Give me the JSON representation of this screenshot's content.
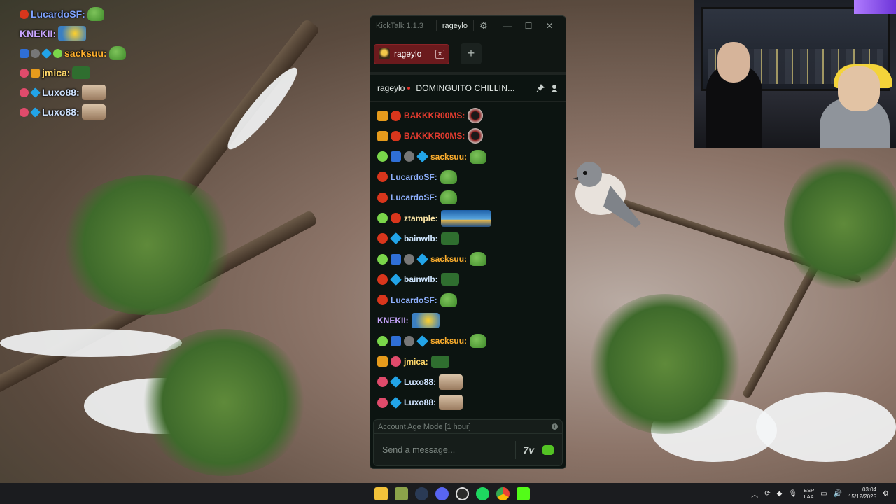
{
  "desktop": {},
  "overlay_chat": [
    {
      "user": "LucardoSF:",
      "color": "#7fa3ff",
      "badges": [
        "b-red"
      ],
      "emote": "e-pepe"
    },
    {
      "user": "KNEKII:",
      "color": "#c9a6ff",
      "badges": [],
      "emote": "e-duck"
    },
    {
      "user": "sacksuu:",
      "color": "#ffb02e",
      "badges": [
        "b-pick",
        "b-gray",
        "b-blue",
        "b-green"
      ],
      "emote": "e-pepe"
    },
    {
      "user": "jmica:",
      "color": "#ffd86a",
      "badges": [
        "b-pink",
        "b-orange"
      ],
      "emote": "e-dark"
    },
    {
      "user": "Luxo88:",
      "color": "#cfe3ff",
      "badges": [
        "b-pink",
        "b-blue"
      ],
      "emote": "e-face"
    },
    {
      "user": "Luxo88:",
      "color": "#cfe3ff",
      "badges": [
        "b-pink",
        "b-blue"
      ],
      "emote": "e-face"
    }
  ],
  "window": {
    "app_title": "KickTalk 1.1.3",
    "user_chip": "rageylo",
    "gear_icon": "⚙",
    "minimize": "—",
    "maximize": "☐",
    "close": "✕"
  },
  "tabs": [
    {
      "label": "rageylo",
      "close": "✕"
    }
  ],
  "add_tab": "+",
  "channel": {
    "name": "rageylo",
    "stream_title": "DOMINGUITO CHILLIN..."
  },
  "messages": [
    {
      "user": "BAKKKR00MS:",
      "color": "#e23b2f",
      "badges": [
        "b-orange",
        "b-red"
      ],
      "emote": "e-bakk"
    },
    {
      "user": "BAKKKR00MS:",
      "color": "#e23b2f",
      "badges": [
        "b-orange",
        "b-red"
      ],
      "emote": "e-bakk"
    },
    {
      "user": "sacksuu:",
      "color": "#ffb02e",
      "badges": [
        "b-green",
        "b-pick",
        "b-gray",
        "b-blue"
      ],
      "emote": "e-pepe"
    },
    {
      "user": "LucardoSF:",
      "color": "#8fb1ff",
      "badges": [
        "b-red"
      ],
      "emote": "e-pepe"
    },
    {
      "user": "LucardoSF:",
      "color": "#8fb1ff",
      "badges": [
        "b-red"
      ],
      "emote": "e-pepe"
    },
    {
      "user": "ztample:",
      "color": "#ffe9a8",
      "badges": [
        "b-green",
        "b-red"
      ],
      "emote": "e-boat"
    },
    {
      "user": "bainwlb:",
      "color": "#cfe6ff",
      "badges": [
        "b-red",
        "b-blue"
      ],
      "emote": "e-dark"
    },
    {
      "user": "sacksuu:",
      "color": "#ffb02e",
      "badges": [
        "b-green",
        "b-pick",
        "b-gray",
        "b-blue"
      ],
      "emote": "e-pepe"
    },
    {
      "user": "bainwlb:",
      "color": "#cfe6ff",
      "badges": [
        "b-red",
        "b-blue"
      ],
      "emote": "e-dark"
    },
    {
      "user": "LucardoSF:",
      "color": "#8fb1ff",
      "badges": [
        "b-red"
      ],
      "emote": "e-pepe"
    },
    {
      "user": "KNEKII:",
      "color": "#c9a6ff",
      "badges": [],
      "emote": "e-duck"
    },
    {
      "user": "sacksuu:",
      "color": "#ffb02e",
      "badges": [
        "b-green",
        "b-pick",
        "b-gray",
        "b-blue"
      ],
      "emote": "e-pepe"
    },
    {
      "user": "jmica:",
      "color": "#ffd86a",
      "badges": [
        "b-orange",
        "b-pink"
      ],
      "emote": "e-dark"
    },
    {
      "user": "Luxo88:",
      "color": "#cfe3ff",
      "badges": [
        "b-pink",
        "b-blue"
      ],
      "emote": "e-face"
    },
    {
      "user": "Luxo88:",
      "color": "#cfe3ff",
      "badges": [
        "b-pink",
        "b-blue"
      ],
      "emote": "e-face"
    }
  ],
  "composer": {
    "mode_label": "Account Age Mode [1 hour]",
    "info_icon": "i",
    "placeholder": "Send a message...",
    "seventv_label": "7v"
  },
  "taskbar": {
    "apps": [
      "windows-start-icon",
      "file-explorer-icon",
      "game-icon",
      "steam-icon",
      "discord-icon",
      "obs-icon",
      "spotify-icon",
      "chrome-icon",
      "kick-icon"
    ],
    "lang_top": "ESP",
    "lang_bottom": "LAA",
    "time": "03:04",
    "date": "15/12/2025"
  }
}
